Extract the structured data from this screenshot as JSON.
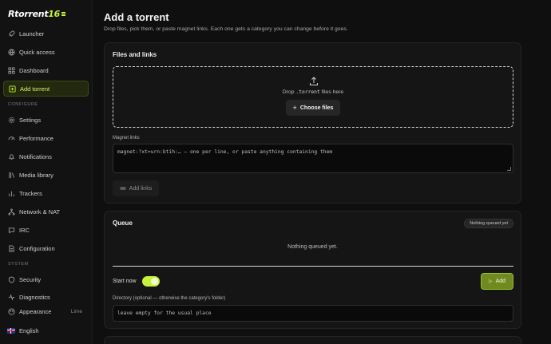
{
  "brand": {
    "name": "Rtorrent",
    "version": "16"
  },
  "sidebar": {
    "items": [
      {
        "label": "Launcher",
        "icon": "rocket-icon"
      },
      {
        "label": "Quick access",
        "icon": "globe-icon"
      },
      {
        "label": "Dashboard",
        "icon": "grid-icon"
      },
      {
        "label": "Add torrent",
        "icon": "plus-square-icon",
        "active": true
      }
    ],
    "configure_label": "CONFIGURE",
    "configure_items": [
      {
        "label": "Settings",
        "icon": "gear-icon"
      },
      {
        "label": "Performance",
        "icon": "gauge-icon"
      },
      {
        "label": "Notifications",
        "icon": "bell-icon"
      },
      {
        "label": "Media library",
        "icon": "library-icon"
      },
      {
        "label": "Trackers",
        "icon": "tracker-icon"
      },
      {
        "label": "Network & NAT",
        "icon": "network-icon"
      },
      {
        "label": "IRC",
        "icon": "chat-icon"
      },
      {
        "label": "Configuration",
        "icon": "document-icon"
      }
    ],
    "system_label": "SYSTEM",
    "system_items": [
      {
        "label": "Security",
        "icon": "shield-icon"
      },
      {
        "label": "Diagnostics",
        "icon": "pulse-icon"
      }
    ],
    "appearance": {
      "label": "Appearance",
      "value": "Lime"
    },
    "language": {
      "label": "English"
    }
  },
  "main": {
    "title": "Add a torrent",
    "subtitle": "Drop files, pick them, or paste magnet links. Each one gets a category you can change before it goes.",
    "files_card": {
      "title": "Files and links",
      "drop_prefix": "Drop ",
      "drop_ext": ".torrent",
      "drop_suffix": " files here",
      "choose_label": "Choose files",
      "magnet_label": "Magnet links",
      "magnet_placeholder": "magnet:?xt=urn:btih:… — one per line, or paste anything containing them",
      "add_links_label": "Add links"
    },
    "queue_card": {
      "title": "Queue",
      "badge": "Nothing queued yet",
      "empty": "Nothing queued yet.",
      "start_now_label": "Start now",
      "start_now_on": true,
      "add_label": "Add",
      "directory_label": "Directory (optional — otherwise the category's folder)",
      "directory_placeholder": "leave empty for the usual place"
    }
  },
  "colors": {
    "accent": "#c5f23a",
    "accent_dark": "#6f8a1f",
    "background": "#0f0f0f",
    "card": "#151515"
  }
}
